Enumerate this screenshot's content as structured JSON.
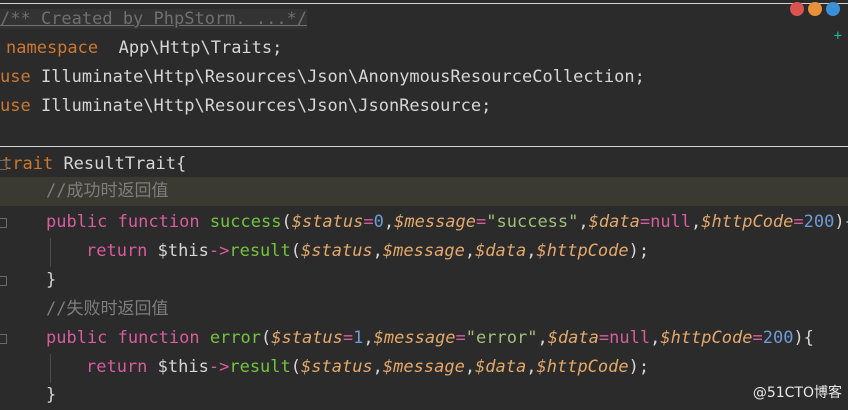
{
  "editor": {
    "doc_comment": "/** Created by PhpStorm. ...*/",
    "line_namespace": {
      "kw": "namespace",
      "value": "App\\Http\\Traits;"
    },
    "line_use1": {
      "kw": "use",
      "value": "Illuminate\\Http\\Resources\\Json\\AnonymousResourceCollection;"
    },
    "line_use2": {
      "kw": "use",
      "value": "Illuminate\\Http\\Resources\\Json\\JsonResource;"
    },
    "trait_kw": "trait",
    "trait_name": "ResultTrait{",
    "comment_success": "//成功时返回值",
    "comment_error": "//失败时返回值",
    "success_fn": {
      "public": "public",
      "function": "function",
      "name": "success",
      "p1": "$status",
      "v1": "0",
      "p2": "$message",
      "v2": "\"success\"",
      "p3": "$data",
      "v3": "null",
      "p4": "$httpCode",
      "v4": "200"
    },
    "error_fn": {
      "public": "public",
      "function": "function",
      "name": "error",
      "p1": "$status",
      "v1": "1",
      "p2": "$message",
      "v2": "\"error\"",
      "p3": "$data",
      "v3": "null",
      "p4": "$httpCode",
      "v4": "200"
    },
    "return_kw": "return",
    "this": "$this",
    "arrow": "->",
    "result": "result",
    "args": {
      "a1": "$status",
      "a2": "$message",
      "a3": "$data",
      "a4": "$httpCode"
    },
    "close_brace": "}"
  },
  "watermark": "@51CTO博客",
  "icons": [
    "chrome-icon",
    "firefox-icon",
    "safari-icon"
  ],
  "colors": {
    "background": "#2b2b2b",
    "keyword": "#cc7832",
    "function": "#72c43e",
    "variable": "#e3a86b"
  }
}
